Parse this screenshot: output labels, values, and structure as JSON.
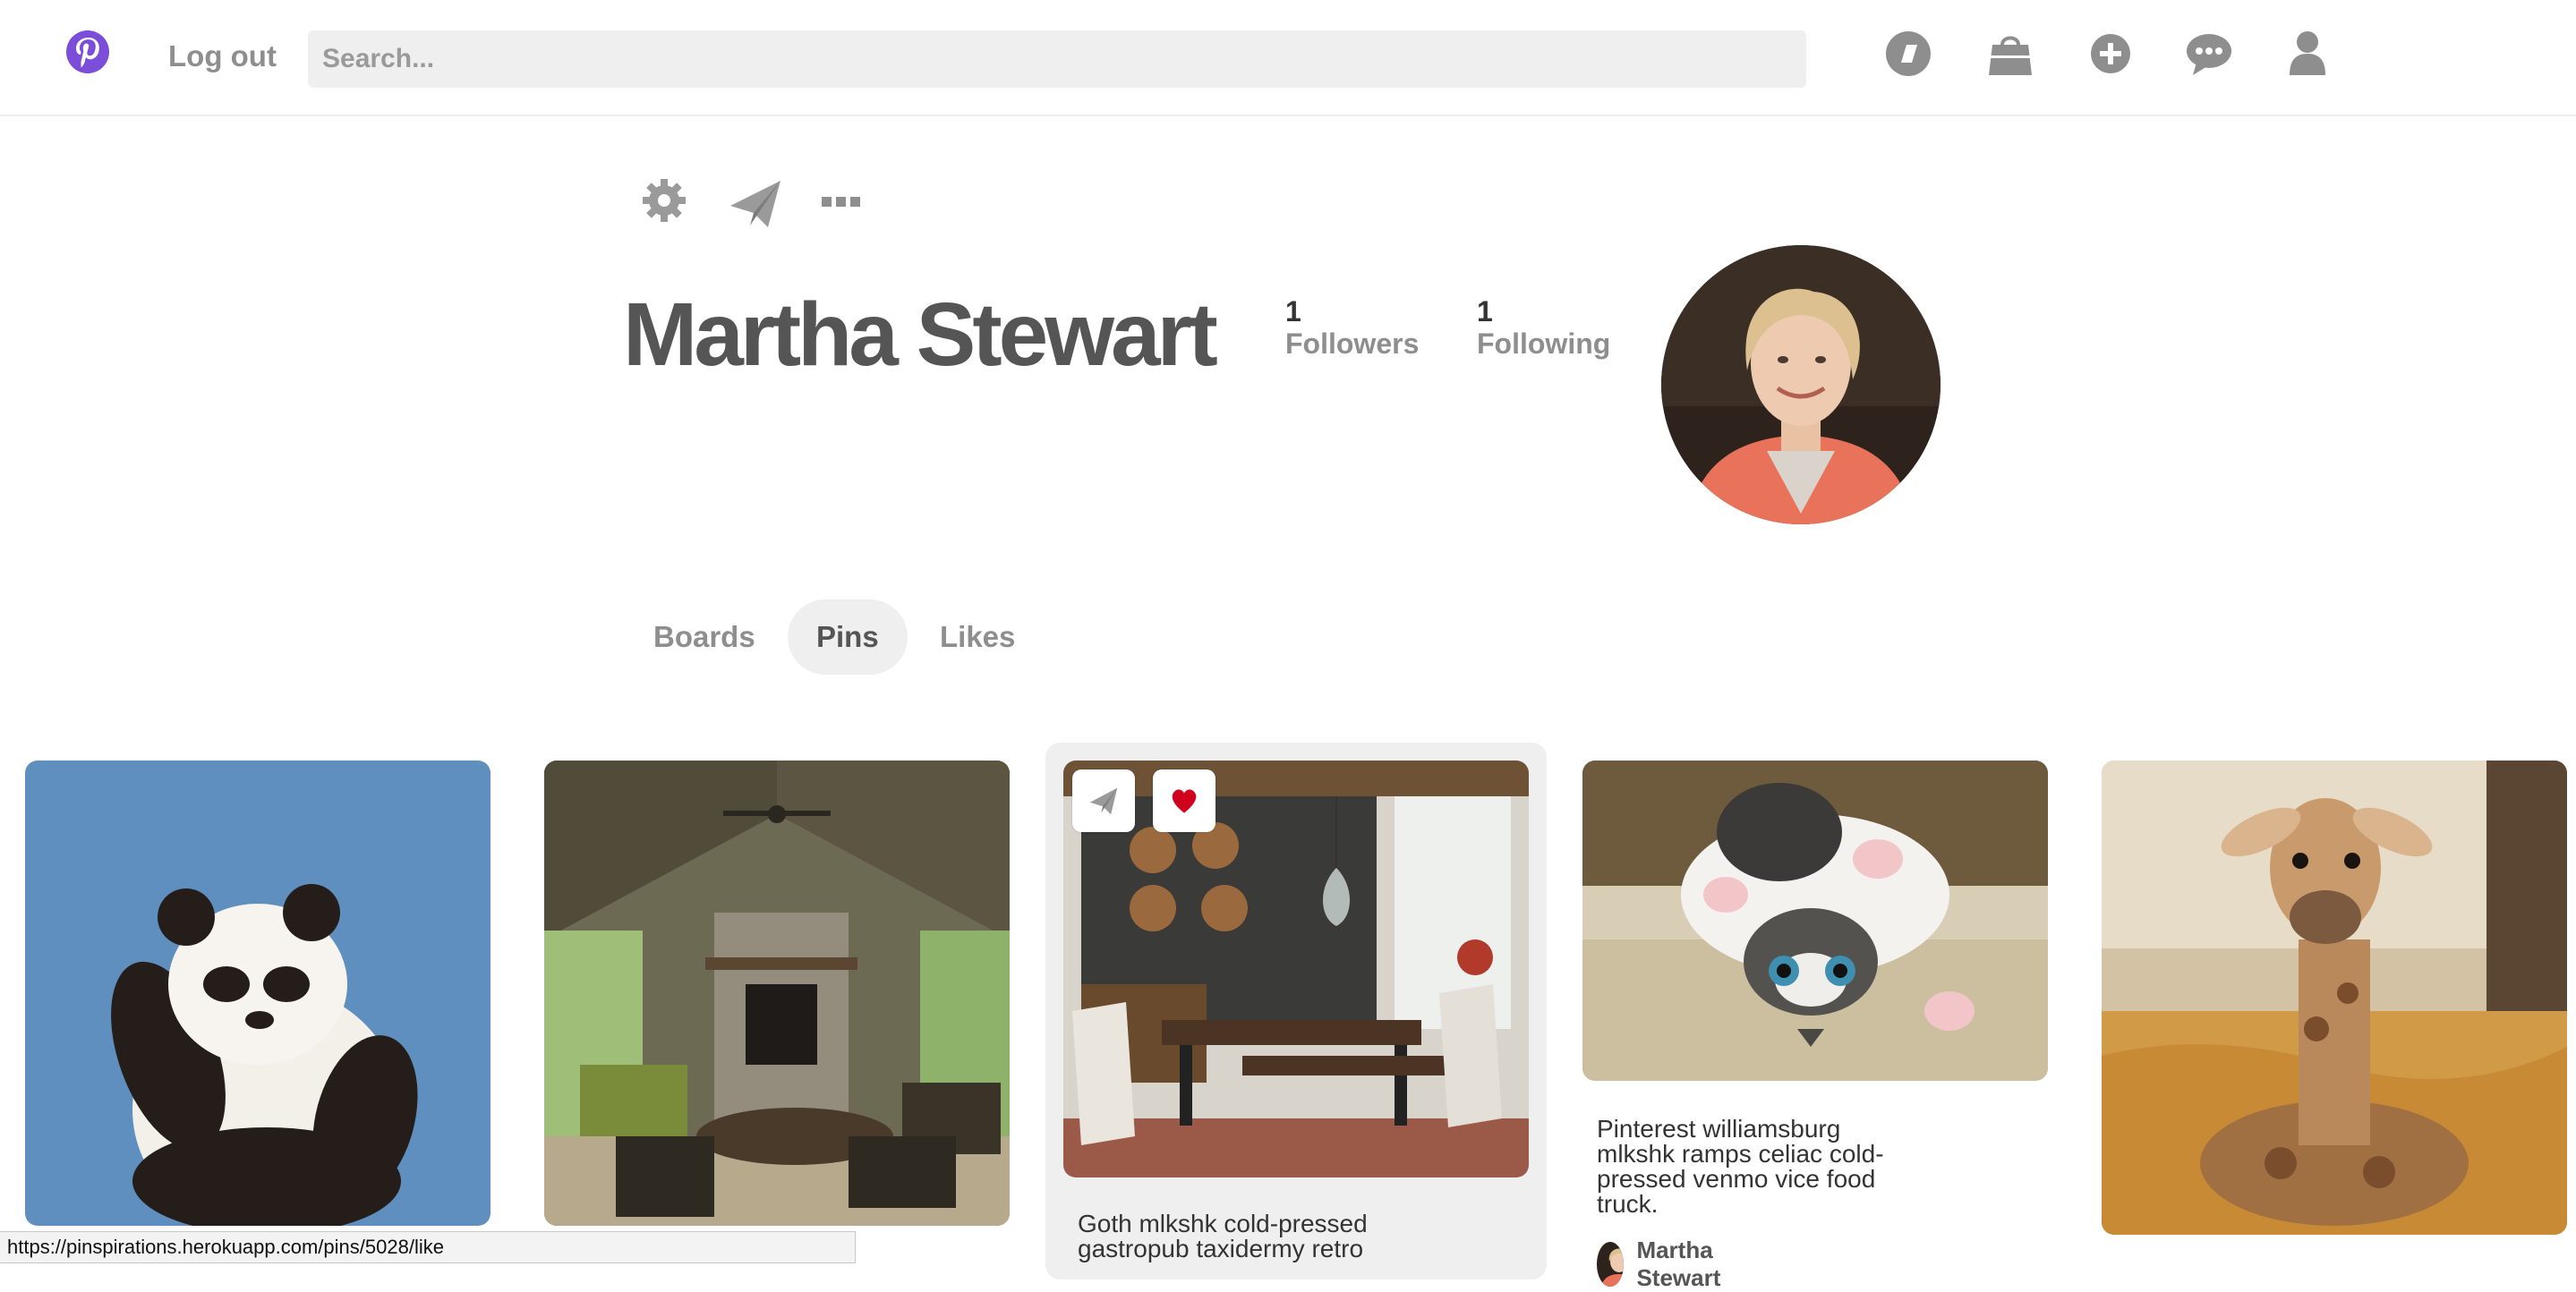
{
  "nav": {
    "logout_label": "Log out",
    "search_placeholder": "Search...",
    "icons": [
      "explore-icon",
      "shopping-bag-icon",
      "add-icon",
      "messages-icon",
      "profile-icon"
    ]
  },
  "profile": {
    "name": "Martha Stewart",
    "followers_count": "1",
    "followers_label": "Followers",
    "following_count": "1",
    "following_label": "Following",
    "toolbar_icons": [
      "gear-icon",
      "send-icon",
      "more-icon"
    ]
  },
  "tabs": [
    {
      "label": "Boards",
      "active": false
    },
    {
      "label": "Pins",
      "active": true
    },
    {
      "label": "Likes",
      "active": false
    }
  ],
  "pins": [
    {
      "subject": "panda",
      "description": "",
      "user": ""
    },
    {
      "subject": "living-room",
      "description": "",
      "user": ""
    },
    {
      "subject": "dining-room",
      "description": "Goth mlkshk cold-pressed gastropub taxidermy retro",
      "user": "",
      "hovered": true
    },
    {
      "subject": "kitten",
      "description": "Pinterest williamsburg mlkshk ramps celiac cold-pressed venmo vice food truck.",
      "user": "Martha Stewart"
    },
    {
      "subject": "giraffe",
      "description": "",
      "user": ""
    }
  ],
  "status_url": "https://pinspirations.herokuapp.com/pins/5028/like",
  "colors": {
    "brand": "#7b4dd8",
    "icon_gray": "#8e8e8e",
    "heart": "#d0021b",
    "tab_active_bg": "#efefef"
  }
}
